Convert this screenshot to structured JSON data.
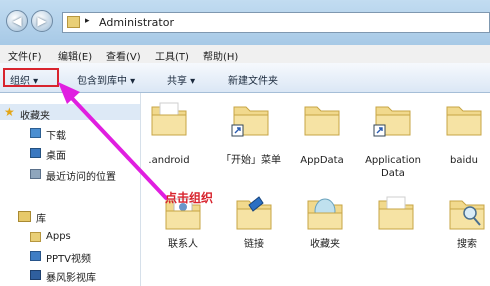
{
  "window": {
    "back_glyph": "◀",
    "forward_glyph": "▶",
    "address_path": "Administrator",
    "path_separator": "▸"
  },
  "menu": {
    "items": [
      "文件(F)",
      "编辑(E)",
      "查看(V)",
      "工具(T)",
      "帮助(H)"
    ]
  },
  "toolbar": {
    "organize": "组织 ▾",
    "include_library": "包含到库中 ▾",
    "share": "共享 ▾",
    "new_folder": "新建文件夹"
  },
  "sidebar": {
    "favorites": "收藏夹",
    "fav_items": [
      "下载",
      "桌面",
      "最近访问的位置"
    ],
    "library": "库",
    "lib_items": [
      "Apps",
      "PPTV视频",
      "暴风影视库"
    ]
  },
  "folders": [
    {
      "label": ".android"
    },
    {
      "label": "「开始」菜单"
    },
    {
      "label": "AppData"
    },
    {
      "label": "Application Data"
    },
    {
      "label": "baidu"
    },
    {
      "label": "联系人"
    },
    {
      "label": "链接"
    },
    {
      "label": "收藏夹"
    },
    {
      "label": ""
    },
    {
      "label": "搜索"
    }
  ],
  "annotation": {
    "text": "点击组织",
    "color": "#d8242e",
    "arrow_color": "#e01fe0"
  }
}
